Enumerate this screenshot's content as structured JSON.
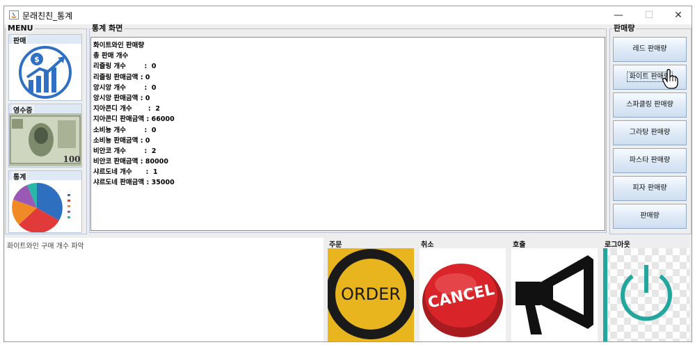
{
  "window": {
    "title": "문래친친_통계",
    "minimize": "—",
    "maximize": "☐",
    "close": "✕"
  },
  "menu": {
    "title": "MENU",
    "items": [
      {
        "label": "판매",
        "icon": "sales-chart-icon"
      },
      {
        "label": "영수증",
        "icon": "money-bill-icon"
      },
      {
        "label": "통계",
        "icon": "pie-chart-icon"
      }
    ]
  },
  "stats_panel": {
    "title": "통계 화면",
    "lines": [
      "화이트와인 판매량",
      "총 판매 개수",
      "리즐링 개수        :  0",
      "리즐링 판매금액 : 0",
      "앙시앙 개수        :  0",
      "앙시앙 판매금액 : 0",
      "지아콘디 개수       :  2",
      "지아콘디 판매금액 : 66000",
      "소비뇽 개수        :  0",
      "소비뇽 판매금액 : 0",
      "비안코 개수        :  2",
      "비안코 판매금액 : 80000",
      "샤르도네 개수      :  1",
      "샤르도네 판매금액 : 35000"
    ]
  },
  "sales_panel": {
    "title": "판매량",
    "buttons": [
      "레드 판매량",
      "화이트 판매량",
      "스파클링 판매량",
      "그라탕 판매량",
      "파스타 판매량",
      "피자 판매량",
      "판매량"
    ]
  },
  "log": {
    "text": "화이트와인 구매 개수 파악"
  },
  "actions": {
    "order": {
      "label": "주문",
      "image_text": "ORDER"
    },
    "cancel": {
      "label": "취소",
      "image_text": "CANCEL"
    },
    "call": {
      "label": "호출"
    },
    "logout": {
      "label": "로그아웃"
    }
  },
  "colors": {
    "order_bg": "#e8b51e",
    "cancel_red": "#d9252a",
    "logout_teal": "#23a69e"
  }
}
